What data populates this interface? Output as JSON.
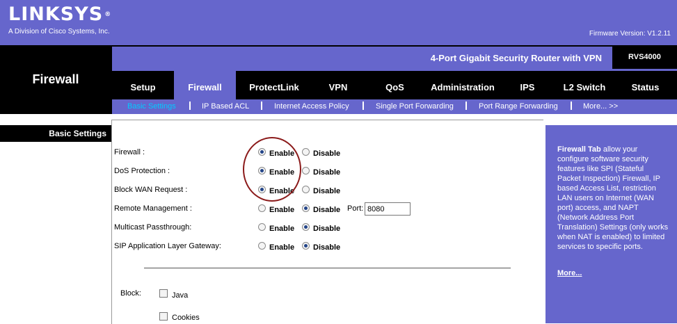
{
  "brand": {
    "logo": "LINKSYS",
    "registered": "®",
    "subtitle": "A Division of Cisco Systems, Inc."
  },
  "firmware": "Firmware Version: V1.2.11",
  "product": {
    "name": "4-Port Gigabit Security Router with VPN",
    "model": "RVS4000"
  },
  "section_title": "Firewall",
  "tabs": [
    {
      "label": "Setup"
    },
    {
      "label": "Firewall",
      "active": true
    },
    {
      "label": "ProtectLink"
    },
    {
      "label": "VPN"
    },
    {
      "label": "QoS"
    },
    {
      "label": "Administration"
    },
    {
      "label": "IPS"
    },
    {
      "label": "L2 Switch"
    },
    {
      "label": "Status"
    }
  ],
  "subtabs": [
    {
      "label": "Basic Settings",
      "active": true
    },
    {
      "label": "IP Based ACL"
    },
    {
      "label": "Internet Access Policy"
    },
    {
      "label": "Single Port Forwarding"
    },
    {
      "label": "Port Range Forwarding"
    },
    {
      "label": "More... >>"
    }
  ],
  "page_heading": "Basic Settings",
  "settings": [
    {
      "label": "Firewall :",
      "enable": "Enable",
      "disable": "Disable",
      "selected": "enable"
    },
    {
      "label": "DoS Protection :",
      "enable": "Enable",
      "disable": "Disable",
      "selected": "enable"
    },
    {
      "label": "Block WAN Request :",
      "enable": "Enable",
      "disable": "Disable",
      "selected": "enable"
    },
    {
      "label": "Remote Management :",
      "enable": "Enable",
      "disable": "Disable",
      "selected": "disable",
      "port_label": "Port:",
      "port_value": "8080"
    },
    {
      "label": "Multicast Passthrough:",
      "enable": "Enable",
      "disable": "Disable",
      "selected": "disable"
    },
    {
      "label": "SIP Application Layer Gateway:",
      "enable": "Enable",
      "disable": "Disable",
      "selected": "disable"
    }
  ],
  "block": {
    "label": "Block:",
    "items": [
      {
        "label": "Java",
        "checked": false
      },
      {
        "label": "Cookies",
        "checked": false
      }
    ]
  },
  "help": {
    "title": "Firewall Tab",
    "body": " allow your configure software security features like SPI (Stateful Packet Inspection) Firewall, IP based Access List, restriction LAN users on Internet (WAN port) access, and NAPT (Network Address Port Translation) Settings (only works when NAT is enabled) to limited services to specific ports.",
    "more": "More..."
  },
  "colors": {
    "brand": "#6666cc",
    "header": "#000000",
    "active_subtab": "#00ccff",
    "annotation": "#8b1a1a"
  }
}
